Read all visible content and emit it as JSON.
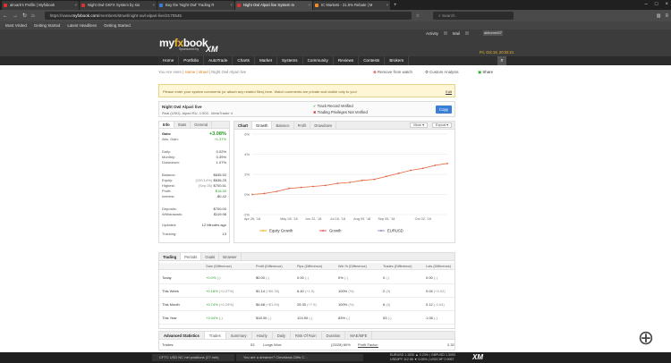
{
  "browser": {
    "tabs": [
      {
        "label": "alruark's Profile | Myfxbook",
        "color": "#e03030",
        "active": false
      },
      {
        "label": "Night Owl GKFX System by sto",
        "color": "#e03030",
        "active": false
      },
      {
        "label": "Buy the 'Night Owl' Trading R",
        "color": "#3a7fd5",
        "active": false
      },
      {
        "label": "Night Owl Alpari live System In",
        "color": "#e03030",
        "active": true
      },
      {
        "label": "IC Markets - 21.5% Rebate | M",
        "color": "#f28c28",
        "active": false
      }
    ],
    "url_prefix": "https://www.",
    "url_domain": "myfxbook.com",
    "url_path": "/members/struel/night-owl-alpari-live/2170545",
    "search_placeholder": "Search",
    "bookmarks": [
      "Most Visited",
      "Getting Started",
      "Latest Headlines",
      "Getting Started"
    ]
  },
  "site": {
    "logo_my": "my",
    "logo_fx": "fx",
    "logo_book": "book",
    "sponsored": "Sponsored by",
    "sponsor": "XM",
    "activity": "Activity",
    "mail": "Mail",
    "username": "akitomer87",
    "datetime": "Fri, Oct 19, 20:02:21",
    "menu": [
      "Home",
      "Portfolio",
      "AutoTrade",
      "Charts",
      "Market",
      "Systems",
      "Community",
      "Reviews",
      "Contests",
      "Brokers"
    ]
  },
  "breadcrumb": {
    "prefix": "You Are Here | ",
    "home": "Home",
    "user": "struel",
    "current": "Night Owl Alpari live"
  },
  "actions": {
    "remove": "Remove from watch",
    "custom": "Custom Analysis",
    "share": "Share"
  },
  "notice": {
    "text": "Please enter your system comments (or attach any related files) here. Watch comments are private and visible only to you!",
    "edit": "Edit"
  },
  "system": {
    "name": "Night Owl Alpari live",
    "meta": "Real (USD), Alpari RU, 1:500 , MetaTrader 4",
    "track": "Track Record Verified",
    "privileges": "Trading Privileges Not Verified",
    "copy": "Copy"
  },
  "info": {
    "tabs": [
      "Info",
      "Stats",
      "General"
    ],
    "rows": [
      {
        "label": "Gain:",
        "value": "+3.08%",
        "green": true
      },
      {
        "label": "Abs. Gain:",
        "value": "+1.37%",
        "green": true
      },
      {
        "label": "Daily:",
        "value": "0.02%"
      },
      {
        "label": "Monthly:",
        "value": "0.39%"
      },
      {
        "label": "Drawdown:",
        "value": "1.07%"
      },
      {
        "label": "Balance:",
        "value": "$635.52"
      },
      {
        "label": "Equity:",
        "sub": "(100.14%)",
        "value": "$636.25"
      },
      {
        "label": "Highest:",
        "sub": "(Sep 06)",
        "value": "$700.51"
      },
      {
        "label": "Profit:",
        "value": "$18.30",
        "green": true
      },
      {
        "label": "Interest:",
        "value": "-$0.42"
      },
      {
        "label": "Deposits:",
        "value": "$700.00"
      },
      {
        "label": "Withdrawals:",
        "value": "$119.98"
      },
      {
        "label": "Updated:",
        "value": "12 Minutes ago"
      },
      {
        "label": "Tracking:",
        "value": "13"
      }
    ]
  },
  "chart_tabs": [
    "Chart",
    "Growth",
    "Balance",
    "Profit",
    "Drawdown"
  ],
  "chart_more": "More",
  "chart_export": "Export",
  "chart_data": {
    "type": "line",
    "x": [
      "Apr 25, '18",
      "May 05, '18",
      "May 15, '18",
      "May 28, '18",
      "Jun 08, '18",
      "Jun 22, '18",
      "Jul 02, '18",
      "Jul 16, '18",
      "Jul 27, '18",
      "Aug 09, '18",
      "Aug 20, '18",
      "Sep 05, '18",
      "Sep 15, '18",
      "Sep 25, '18",
      "Oct 02, '18",
      "Oct 10, '18",
      "Oct 19, '18"
    ],
    "xticks": [
      "Apr 26, '18",
      "May 28, '18",
      "Jun 22, '18",
      "Jul 16, '18",
      "Aug 09, '18",
      "Sep 05, '18",
      "Oct 02, '18"
    ],
    "series": [
      {
        "name": "Equity Growth",
        "color": "#f2b632",
        "values": [
          0,
          0.1,
          0.3,
          0.6,
          0.7,
          0.8,
          0.9,
          1.1,
          1.2,
          1.4,
          1.5,
          1.8,
          2.1,
          2.4,
          2.6,
          2.9,
          3.1
        ]
      },
      {
        "name": "Growth",
        "color": "#e05a5a",
        "values": [
          0,
          0.1,
          0.3,
          0.6,
          0.7,
          0.8,
          0.9,
          1.1,
          1.2,
          1.4,
          1.5,
          1.8,
          2.1,
          2.4,
          2.6,
          2.9,
          3.08
        ]
      },
      {
        "name": "EURUSD",
        "color": "#9090c0",
        "values": []
      }
    ],
    "yticks": [
      "6%",
      "4%",
      "2%",
      "0%",
      "-2%"
    ],
    "ylim": [
      -2,
      6
    ]
  },
  "trading": {
    "tabs": [
      "Trading",
      "Periods",
      "Goals",
      "Browser"
    ],
    "headers": [
      "Gain (Difference)",
      "Profit (Difference)",
      "Pips (Difference)",
      "Win % (Difference)",
      "Trades (Difference)",
      "Lots (Difference)"
    ],
    "rows": [
      {
        "period": "Today",
        "gain": "+0.0%",
        "gain_d": "(-)",
        "profit": "$0.00",
        "profit_d": "(-)",
        "pips": "0.00",
        "pips_d": "(-)",
        "win": "0%",
        "win_d": "(-)",
        "trades": "0",
        "trades_d": "(-)",
        "lots": "0.00",
        "lots_d": "(-)"
      },
      {
        "period": "This Week",
        "gain": "+0.18%",
        "gain_d": "(+0.07%)",
        "profit": "$1.14",
        "profit_d": "(+$0.35)",
        "pips": "6.40",
        "pips_d": "(+1.5)",
        "win": "100%",
        "win_d": "(%)",
        "trades": "2",
        "trades_d": "(0)",
        "lots": "0.04",
        "lots_d": "(+0.02)"
      },
      {
        "period": "This Month",
        "gain": "+0.74%",
        "gain_d": "(+0.29%)",
        "profit": "$4.68",
        "profit_d": "(+$1.69)",
        "pips": "25.30",
        "pips_d": "(+7.9)",
        "win": "100%",
        "win_d": "(%)",
        "trades": "6",
        "trades_d": "(0)",
        "lots": "0.12",
        "lots_d": "(-0.04)"
      },
      {
        "period": "This Year",
        "gain": "+3.04%",
        "gain_d": "(-)",
        "profit": "$18.30",
        "profit_d": "(-)",
        "pips": "124.90",
        "pips_d": "(-)",
        "win": "83%",
        "win_d": "(-)",
        "trades": "53",
        "trades_d": "(-)",
        "lots": "1.08",
        "lots_d": "(-)"
      }
    ]
  },
  "advanced": {
    "title": "Advanced Statistics",
    "tabs": [
      "Trades",
      "Summary",
      "Hourly",
      "Daily",
      "Risk Of Ruin",
      "Duration",
      "MAE/MFE"
    ],
    "trades_label": "Trades:",
    "trades_value": "53",
    "longs_label": "Longs Won:",
    "longs_value": "(23/28) 80%",
    "pf_label": "Profit Factor:",
    "pf_value": "2.32"
  },
  "bottom": {
    "item1": "CFTC USD NC net positions (27 min)",
    "item2": "You are a dreamer? Cleveland-Cliffs C...",
    "ticker1": "EURUSD 1.1530 ▲ 0.23% | GBPUSD 1.3093",
    "ticker2": "USDJPY 112.56 ▼ 0.05% | USDCHF 0.9957",
    "brand": "XM"
  }
}
